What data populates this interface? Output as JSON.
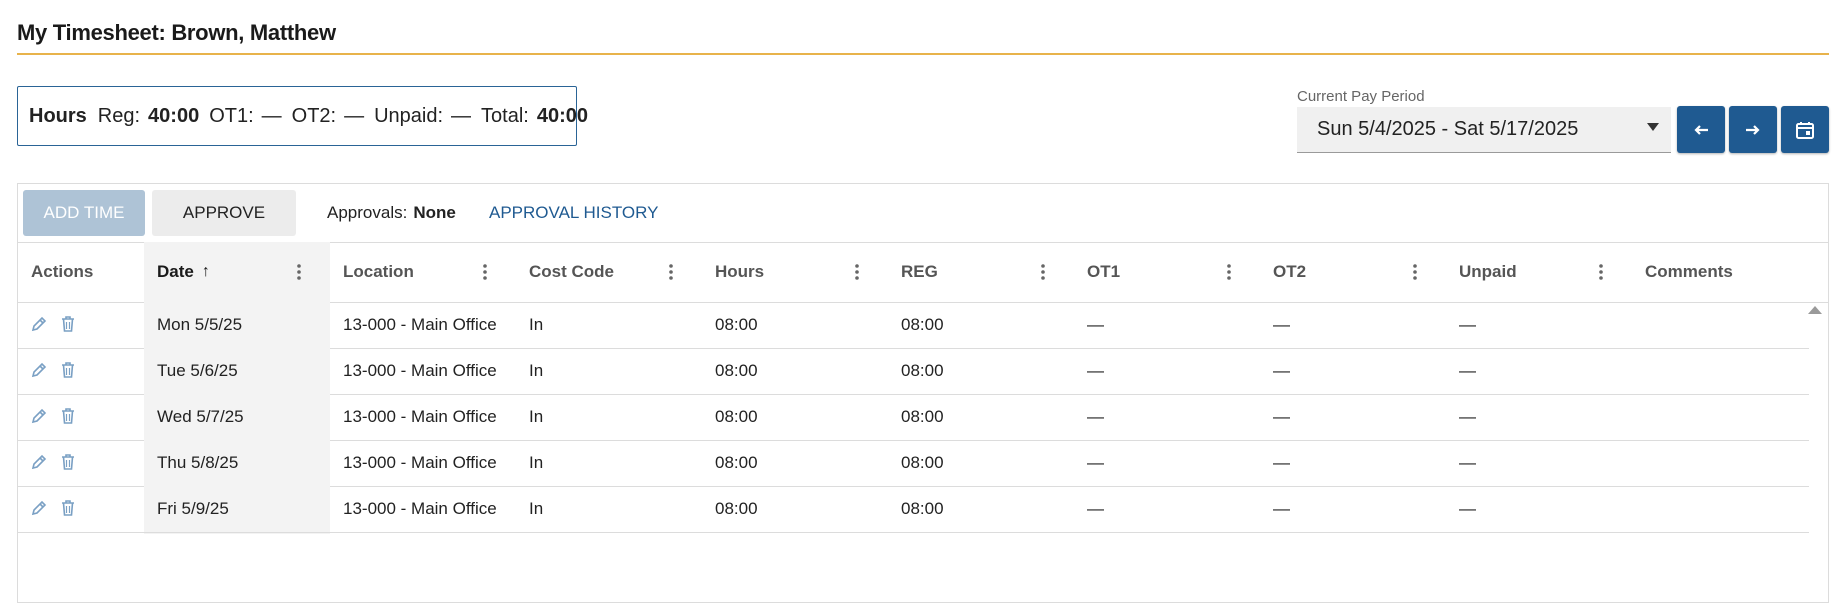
{
  "page": {
    "title": "My Timesheet: Brown, Matthew",
    "accent_color": "#e8b34b",
    "primary_color": "#1f5a91"
  },
  "hours_summary": {
    "label": "Hours",
    "reg_label": "Reg:",
    "reg_value": "40:00",
    "ot1_label": "OT1:",
    "ot1_value": "—",
    "ot2_label": "OT2:",
    "ot2_value": "—",
    "unpaid_label": "Unpaid:",
    "unpaid_value": "—",
    "total_label": "Total:",
    "total_value": "40:00"
  },
  "pay_period": {
    "label": "Current Pay Period",
    "value": "Sun 5/4/2025 - Sat 5/17/2025",
    "prev_icon": "arrow-left-icon",
    "next_icon": "arrow-right-icon",
    "calendar_icon": "calendar-icon"
  },
  "toolbar": {
    "add_time_label": "ADD TIME",
    "approve_label": "APPROVE",
    "approvals_label": "Approvals:",
    "approvals_value": "None",
    "approval_history_label": "APPROVAL HISTORY"
  },
  "columns": {
    "actions": "Actions",
    "date": "Date",
    "location": "Location",
    "cost_code": "Cost Code",
    "hours": "Hours",
    "reg": "REG",
    "ot1": "OT1",
    "ot2": "OT2",
    "unpaid": "Unpaid",
    "comments": "Comments"
  },
  "rows": [
    {
      "date": "Mon 5/5/25",
      "location": "13-000 - Main Office",
      "cost_code": "In",
      "hours": "08:00",
      "reg": "08:00",
      "ot1": "—",
      "ot2": "—",
      "unpaid": "—",
      "comments": ""
    },
    {
      "date": "Tue 5/6/25",
      "location": "13-000 - Main Office",
      "cost_code": "In",
      "hours": "08:00",
      "reg": "08:00",
      "ot1": "—",
      "ot2": "—",
      "unpaid": "—",
      "comments": ""
    },
    {
      "date": "Wed 5/7/25",
      "location": "13-000 - Main Office",
      "cost_code": "In",
      "hours": "08:00",
      "reg": "08:00",
      "ot1": "—",
      "ot2": "—",
      "unpaid": "—",
      "comments": ""
    },
    {
      "date": "Thu 5/8/25",
      "location": "13-000 - Main Office",
      "cost_code": "In",
      "hours": "08:00",
      "reg": "08:00",
      "ot1": "—",
      "ot2": "—",
      "unpaid": "—",
      "comments": ""
    },
    {
      "date": "Fri 5/9/25",
      "location": "13-000 - Main Office",
      "cost_code": "In",
      "hours": "08:00",
      "reg": "08:00",
      "ot1": "—",
      "ot2": "—",
      "unpaid": "—",
      "comments": ""
    }
  ]
}
